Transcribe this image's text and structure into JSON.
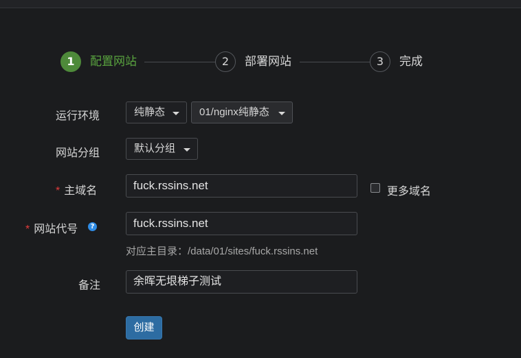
{
  "steps": [
    {
      "number": "1",
      "label": "配置网站",
      "state": "active"
    },
    {
      "number": "2",
      "label": "部署网站",
      "state": "pending"
    },
    {
      "number": "3",
      "label": "完成",
      "state": "pending"
    }
  ],
  "form": {
    "runtime": {
      "label": "运行环境",
      "type_value": "纯静态",
      "version_value": "01/nginx纯静态"
    },
    "group": {
      "label": "网站分组",
      "value": "默认分组"
    },
    "domain": {
      "required_mark": "*",
      "label": "主域名",
      "value": "fuck.rssins.net",
      "more_domains_label": "更多域名",
      "more_domains_checked": false
    },
    "site_code": {
      "required_mark": "*",
      "label": "网站代号",
      "help_icon": "question-circle-icon",
      "help_glyph": "?",
      "value": "fuck.rssins.net",
      "hint": "对应主目录：/data/01/sites/fuck.rssins.net"
    },
    "note": {
      "label": "备注",
      "value": "余晖无垠梯子测试"
    },
    "submit_label": "创建"
  },
  "colors": {
    "background": "#1b1c1e",
    "active_step": "#4e8a3a",
    "primary_button": "#2d6ca2",
    "required": "#e23b3b",
    "help_icon": "#2f8ce6"
  }
}
